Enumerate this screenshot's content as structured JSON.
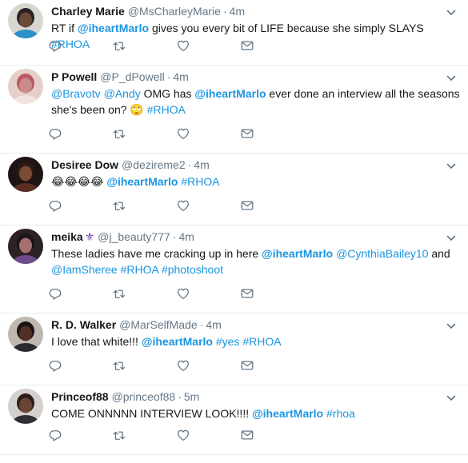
{
  "tweets": [
    {
      "name": "Charley Marie",
      "handle": "@MsCharleyMarie",
      "time": "4m",
      "text": [
        {
          "type": "text",
          "v": "RT if "
        },
        {
          "type": "mention",
          "v": "@iheartMarlo",
          "bold": true
        },
        {
          "type": "text",
          "v": " gives you every bit of LIFE because she simply SLAYS "
        },
        {
          "type": "tag",
          "v": "#RHOA"
        }
      ],
      "avatar": {
        "bg": "#d8d6d0",
        "skin": "#6b4a3a",
        "hair": "#2a2224",
        "shirt": "#2e8fc9"
      }
    },
    {
      "name": "P Powell",
      "handle": "@P_dPowell",
      "time": "4m",
      "text": [
        {
          "type": "mention",
          "v": "@Bravotv"
        },
        {
          "type": "text",
          "v": " "
        },
        {
          "type": "mention",
          "v": "@Andy"
        },
        {
          "type": "text",
          "v": " OMG has "
        },
        {
          "type": "mention",
          "v": "@iheartMarlo",
          "bold": true
        },
        {
          "type": "text",
          "v": " ever done an interview all the seasons she's been on? 🙄 "
        },
        {
          "type": "tag",
          "v": "#RHOA"
        }
      ],
      "avatar": {
        "bg": "#e6cfc8",
        "skin": "#c98a88",
        "hair": "#b85866",
        "shirt": "#f1e4e0"
      }
    },
    {
      "name": "Desiree Dow",
      "handle": "@dezireme2",
      "time": "4m",
      "text": [
        {
          "type": "text",
          "v": "😂😂😂😂 "
        },
        {
          "type": "mention",
          "v": "@iheartMarlo",
          "bold": true
        },
        {
          "type": "text",
          "v": " "
        },
        {
          "type": "tag",
          "v": "#RHOA"
        }
      ],
      "avatar": {
        "bg": "#1e1414",
        "skin": "#7a4a34",
        "hair": "#2a1a14",
        "shirt": "#5a2e22"
      }
    },
    {
      "name": "meika",
      "badge": "⚜",
      "handle": "@j_beauty777",
      "time": "4m",
      "text": [
        {
          "type": "text",
          "v": "These ladies have me cracking up in here   "
        },
        {
          "type": "mention",
          "v": "@iheartMarlo",
          "bold": true
        },
        {
          "type": "text",
          "v": " "
        },
        {
          "type": "mention",
          "v": "@CynthiaBailey10"
        },
        {
          "type": "text",
          "v": " and "
        },
        {
          "type": "mention",
          "v": "@IamSheree"
        },
        {
          "type": "text",
          "v": "  "
        },
        {
          "type": "tag",
          "v": "#RHOA"
        },
        {
          "type": "text",
          "v": " "
        },
        {
          "type": "tag",
          "v": "#photoshoot"
        }
      ],
      "avatar": {
        "bg": "#2c2226",
        "skin": "#a47070",
        "hair": "#1a1416",
        "shirt": "#6e4c8c"
      }
    },
    {
      "name": "R. D. Walker",
      "handle": "@MarSelfMade",
      "time": "4m",
      "text": [
        {
          "type": "text",
          "v": "I love that white!!! "
        },
        {
          "type": "mention",
          "v": "@iheartMarlo",
          "bold": true
        },
        {
          "type": "text",
          "v": " "
        },
        {
          "type": "tag",
          "v": "#yes"
        },
        {
          "type": "text",
          "v": " "
        },
        {
          "type": "tag",
          "v": "#RHOA"
        }
      ],
      "avatar": {
        "bg": "#bfb8b0",
        "skin": "#4e3026",
        "hair": "#1a1210",
        "shirt": "#2a2a30"
      }
    },
    {
      "name": "Princeof88",
      "handle": "@princeof88",
      "time": "5m",
      "text": [
        {
          "type": "text",
          "v": "COME ONNNNN INTERVIEW LOOK!!!! "
        },
        {
          "type": "mention",
          "v": "@iheartMarlo",
          "bold": true
        },
        {
          "type": "text",
          "v": " "
        },
        {
          "type": "tag",
          "v": "#rhoa"
        }
      ],
      "avatar": {
        "bg": "#d4d0ce",
        "skin": "#6a4436",
        "hair": "#2a1c18",
        "shirt": "#2e2e36"
      }
    }
  ],
  "actions": [
    "reply-icon",
    "retweet-icon",
    "like-icon",
    "dm-icon"
  ],
  "colors": {
    "link": "#1b95e0",
    "muted": "#657786",
    "divider": "#e6ecf0",
    "text": "#14171a"
  }
}
